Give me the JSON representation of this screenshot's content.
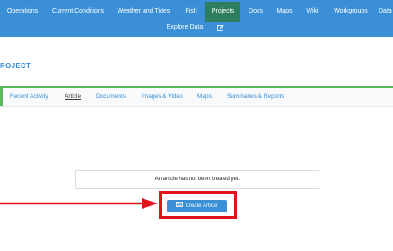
{
  "colors": {
    "nav_bg": "#3a8fd6",
    "nav_active": "#2e7d5e",
    "accent_green": "#5cb85c",
    "link_blue": "#3a8fd6",
    "annotation_red": "#e0121b"
  },
  "nav": {
    "items": [
      {
        "label": "Operations"
      },
      {
        "label": "Current Conditions"
      },
      {
        "label": "Weather and Tides"
      },
      {
        "label": "Fish"
      },
      {
        "label": "Projects",
        "active": true
      },
      {
        "label": "Docs"
      },
      {
        "label": "Maps"
      },
      {
        "label": "Wiki"
      },
      {
        "label": "Workgroups"
      },
      {
        "label": "Data"
      }
    ],
    "row2": {
      "explore_label": "Explore Data",
      "edit_icon": "pencil-square-icon"
    }
  },
  "page": {
    "title": "ROJECT"
  },
  "tabs": [
    {
      "label": "Recent Activity"
    },
    {
      "label": "Article",
      "active": true
    },
    {
      "label": "Documents"
    },
    {
      "label": "Images & Video"
    },
    {
      "label": "Maps"
    },
    {
      "label": "Summaries & Reports"
    }
  ],
  "article": {
    "empty_message": "An article has not been created yet.",
    "create_button_label": "Create Article",
    "create_button_icon": "newspaper-icon"
  },
  "annotation": {
    "arrow_icon": "red-arrow-icon"
  }
}
